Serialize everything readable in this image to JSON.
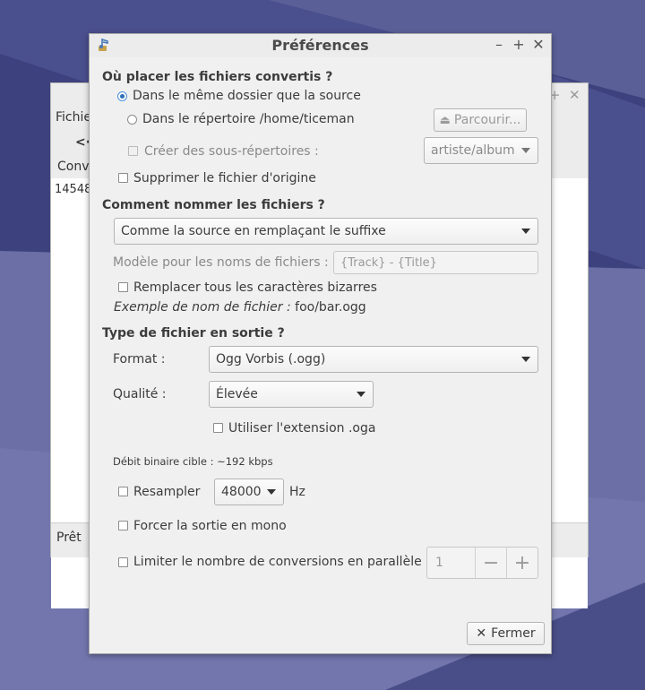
{
  "background_window": {
    "menu_partial": "Fichie",
    "column_partial": "Conv",
    "row_partial": "14548",
    "status": "Prêt"
  },
  "dialog": {
    "title": "Préférences",
    "section_location": "Où placer les fichiers convertis ?",
    "radio_same_folder": "Dans le même dossier que la source",
    "radio_directory": "Dans le répertoire /home/ticeman",
    "browse_button": "Parcourir...",
    "subdirs_label": "Créer des sous-répertoires :",
    "subdirs_value": "artiste/album",
    "delete_original": "Supprimer le fichier d'origine",
    "section_naming": "Comment nommer les fichiers ?",
    "naming_value": "Comme la source en remplaçant le suffixe",
    "pattern_label": "Modèle pour les noms de fichiers : -",
    "pattern_value": "{Track} - {Title}",
    "replace_weird": "Remplacer tous les caractères bizarres",
    "example_label": "Exemple de nom de fichier :",
    "example_value": "foo/bar.ogg",
    "section_type": "Type de fichier en sortie ?",
    "format_label": "Format :",
    "format_value": "Ogg Vorbis (.ogg)",
    "quality_label": "Qualité :",
    "quality_value": "Élevée",
    "oga_ext": "Utiliser l'extension .oga",
    "bitrate": "Débit binaire cible : ~192 kbps",
    "resample_label": "Resampler",
    "resample_value": "48000",
    "hz": "Hz",
    "force_mono": "Forcer la sortie en mono",
    "limit_conversions": "Limiter le nombre de conversions en parallèle",
    "limit_value": "1",
    "minus": "−",
    "plus": "+",
    "close_button": "Fermer",
    "close_icon": "✕"
  },
  "colors": {
    "radio_accent": "#2e6fb8",
    "dialog_bg": "#f0f0f0"
  }
}
